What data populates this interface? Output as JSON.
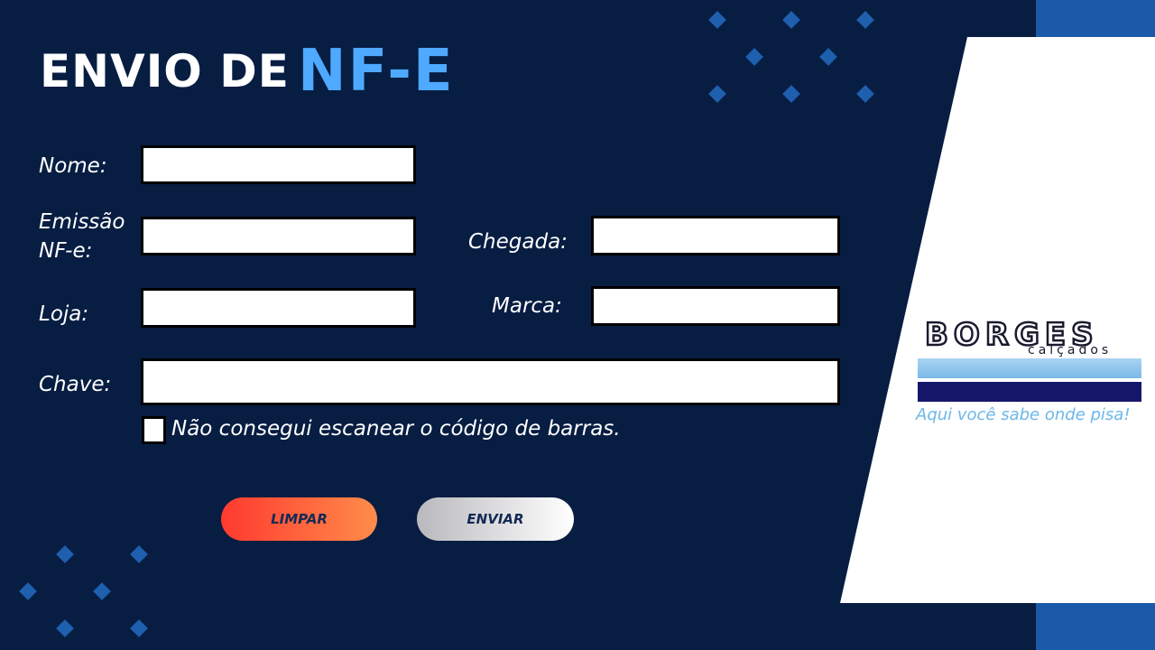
{
  "header": {
    "title_prefix": "ENVIO DE",
    "title_highlight": "NF-E"
  },
  "form": {
    "nome": {
      "label": "Nome:",
      "value": ""
    },
    "emissao": {
      "label_line1": "Emissão",
      "label_line2": "NF-e:",
      "value": ""
    },
    "chegada": {
      "label": "Chegada:",
      "value": ""
    },
    "loja": {
      "label": "Loja:",
      "value": ""
    },
    "marca": {
      "label": "Marca:",
      "value": ""
    },
    "chave": {
      "label": "Chave:",
      "value": ""
    },
    "no_barcode": {
      "label": "Não consegui escanear o código de barras.",
      "checked": false
    }
  },
  "buttons": {
    "clear": "LIMPAR",
    "send": "ENVIAR"
  },
  "brand": {
    "name": "BORGES",
    "sub": "calçados",
    "slogan": "Aqui você sabe onde pisa!"
  },
  "colors": {
    "background": "#071d42",
    "accent": "#4ea9ff",
    "band": "#1a5aa8",
    "clear_start": "#ff3a2f",
    "clear_end": "#ff8c4a"
  }
}
